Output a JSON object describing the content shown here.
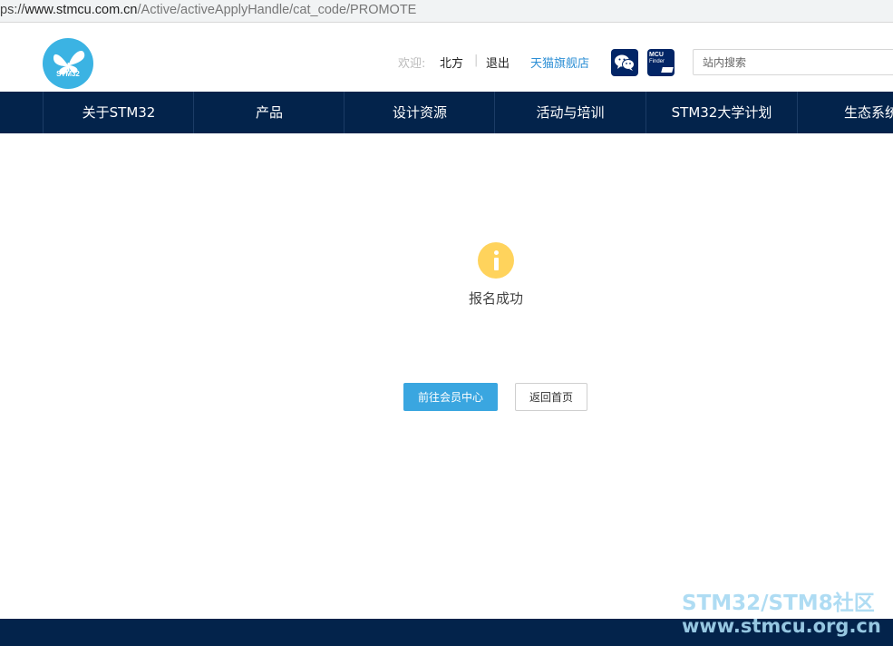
{
  "address_bar": {
    "prefix": "ps://",
    "host": "www.stmcu.com.cn",
    "path": "/Active/activeApplyHandle/cat_code/PROMOTE"
  },
  "header": {
    "logo_text": "STM32",
    "welcome_label": "欢迎:",
    "username": "北方",
    "separator": "|",
    "logout_label": "退出",
    "tmall_label": "天猫旗舰店",
    "wechat_icon": "wechat-icon",
    "mcu_finder": {
      "line1": "MCU",
      "line2": "Finder"
    },
    "search_placeholder": "站内搜索"
  },
  "nav": {
    "items": [
      {
        "label": "关于STM32"
      },
      {
        "label": "产品"
      },
      {
        "label": "设计资源"
      },
      {
        "label": "活动与培训"
      },
      {
        "label": "STM32大学计划"
      },
      {
        "label": "生态系统"
      }
    ]
  },
  "main": {
    "status_icon": "info-icon",
    "message": "报名成功",
    "primary_button": "前往会员中心",
    "secondary_button": "返回首页"
  },
  "watermark": {
    "line1": "STM32/STM8社区",
    "line2": "www.stmcu.org.cn"
  },
  "colors": {
    "nav_bg": "#03234b",
    "accent": "#3aa6e0",
    "info_icon": "#ffd35c",
    "logo": "#3bb3e3"
  }
}
